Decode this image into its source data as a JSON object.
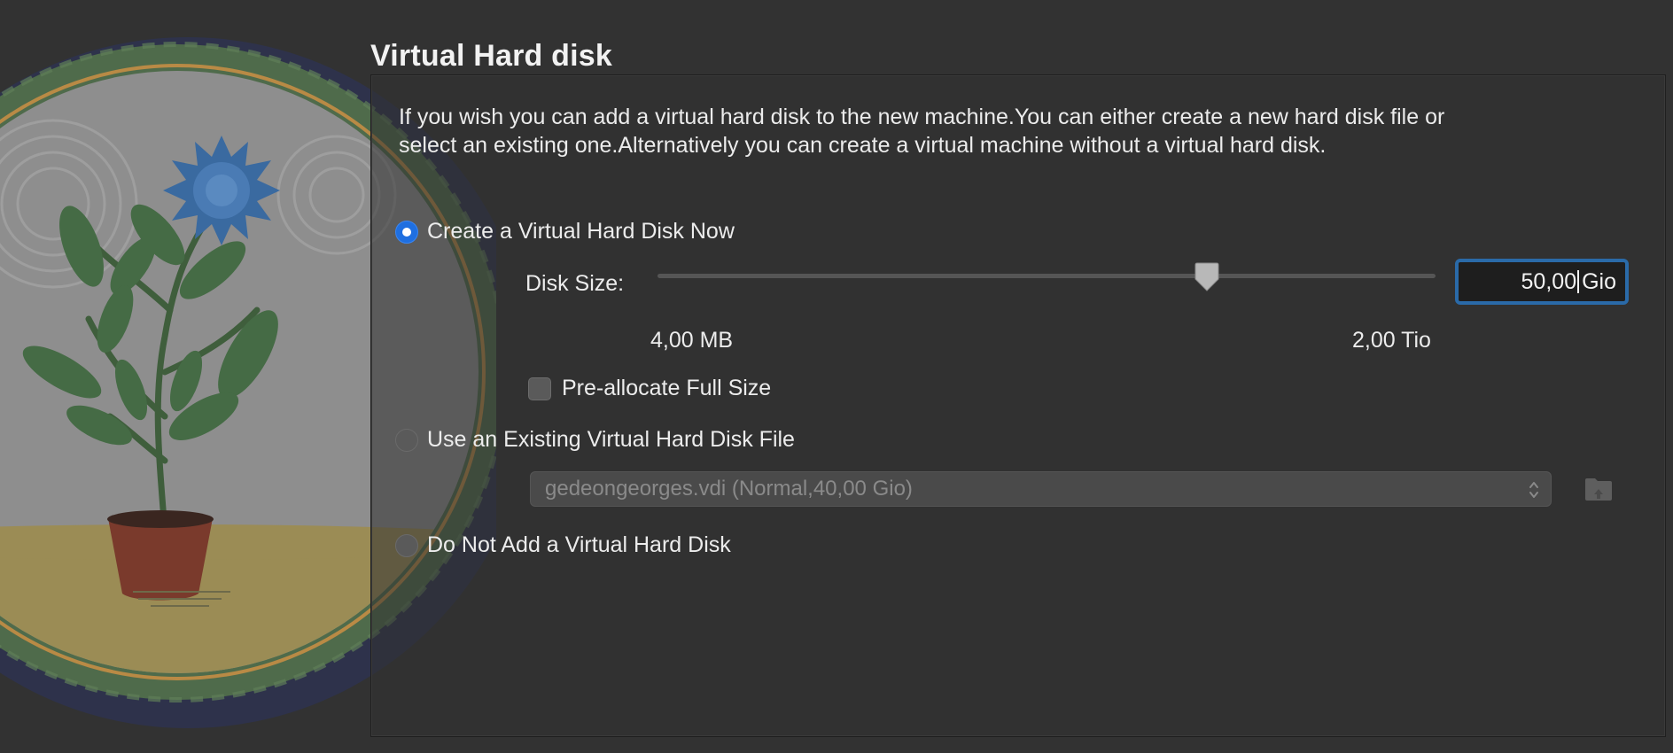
{
  "page": {
    "title": "Virtual Hard disk",
    "description": "If you wish you can add a virtual hard disk to the new machine.You can either create a new hard disk file or select an existing one.Alternatively you can create a virtual machine without a virtual hard disk."
  },
  "options": {
    "create_now": {
      "label": "Create a Virtual Hard Disk Now",
      "selected": true
    },
    "use_existing": {
      "label": "Use an Existing Virtual Hard Disk File",
      "selected": false
    },
    "do_not_add": {
      "label": "Do Not Add a Virtual Hard Disk",
      "selected": false
    }
  },
  "disk_size": {
    "label": "Disk Size:",
    "min_label": "4,00 MB",
    "max_label": "2,00 Tio",
    "slider_fraction": 0.706,
    "value": "50,00",
    "unit": "Gio"
  },
  "preallocate": {
    "label": "Pre-allocate Full Size",
    "checked": false
  },
  "existing_file": {
    "selected_value": "gedeongeorges.vdi (Normal,40,00 Gio)",
    "chevron_icon": "chevron-up-down-icon",
    "folder_icon": "folder-icon"
  },
  "colors": {
    "accent": "#1f6fe0",
    "focus_ring": "#2a6aa8",
    "background": "#323232"
  }
}
